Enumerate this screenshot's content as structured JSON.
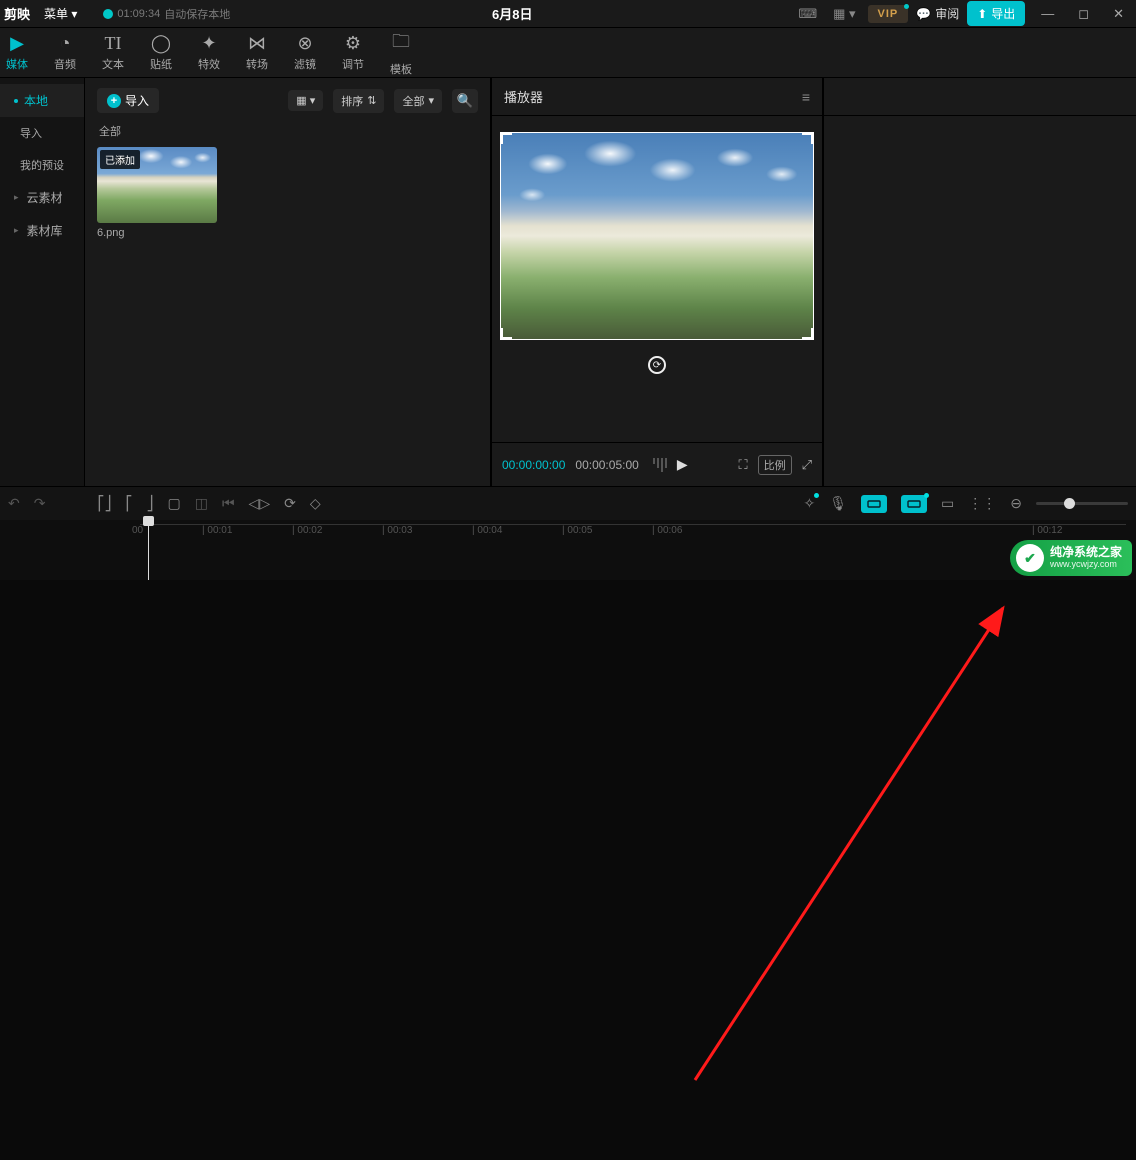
{
  "titlebar": {
    "app_name": "剪映",
    "menu_label": "菜单",
    "saved_time": "01:09:34",
    "saved_text": "自动保存本地",
    "project_title": "6月8日",
    "vip_label": "VIP",
    "review_label": "审阅",
    "export_label": "导出"
  },
  "tooltabs": [
    {
      "label": "媒体",
      "active": true
    },
    {
      "label": "音频"
    },
    {
      "label": "文本"
    },
    {
      "label": "贴纸"
    },
    {
      "label": "特效"
    },
    {
      "label": "转场"
    },
    {
      "label": "滤镜"
    },
    {
      "label": "调节"
    },
    {
      "label": "模板"
    }
  ],
  "sidebar": {
    "local": "本地",
    "import": "导入",
    "my_preset": "我的预设",
    "cloud_assets": "云素材",
    "asset_lib": "素材库"
  },
  "media": {
    "import_btn": "导入",
    "sort_label": "排序",
    "filter_label": "全部",
    "subhead": "全部",
    "thumb_badge": "已添加",
    "thumb_name": "6.png"
  },
  "player": {
    "title": "播放器",
    "tc_current": "00:00:00:00",
    "tc_total": "00:00:05:00",
    "ratio_label": "比例"
  },
  "timeline": {
    "marks": [
      "00",
      "00:01",
      "00:02",
      "00:03",
      "00:04",
      "00:05",
      "00:06",
      "00:12"
    ]
  },
  "watermark": {
    "title": "纯净系统之家",
    "url": "www.ycwjzy.com"
  }
}
